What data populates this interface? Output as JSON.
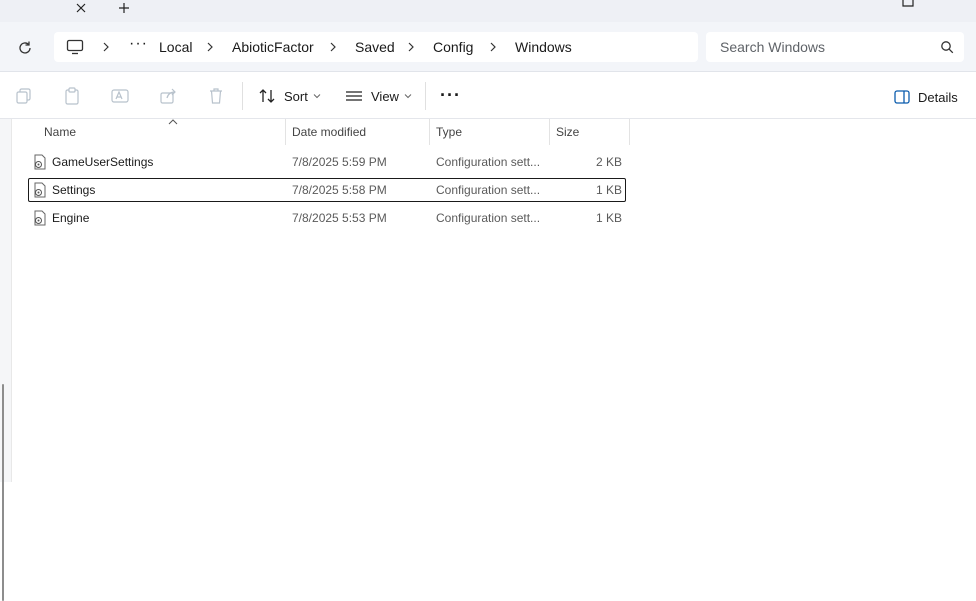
{
  "title_bar": {
    "close_tab_icon": "close-icon",
    "new_tab_icon": "plus-icon"
  },
  "address": {
    "root_icon": "computer-icon",
    "overflow": "···",
    "crumbs": [
      "Local",
      "AbioticFactor",
      "Saved",
      "Config",
      "Windows"
    ]
  },
  "search": {
    "placeholder": "Search Windows"
  },
  "toolbar": {
    "sort_label": "Sort",
    "view_label": "View",
    "more_label": "···",
    "details_label": "Details"
  },
  "columns": {
    "name": "Name",
    "date": "Date modified",
    "type": "Type",
    "size": "Size"
  },
  "files": [
    {
      "name": "GameUserSettings",
      "date": "7/8/2025 5:59 PM",
      "type": "Configuration sett...",
      "size": "2 KB",
      "selected": false
    },
    {
      "name": "Settings",
      "date": "7/8/2025 5:58 PM",
      "type": "Configuration sett...",
      "size": "1 KB",
      "selected": true
    },
    {
      "name": "Engine",
      "date": "7/8/2025 5:53 PM",
      "type": "Configuration sett...",
      "size": "1 KB",
      "selected": false
    }
  ]
}
